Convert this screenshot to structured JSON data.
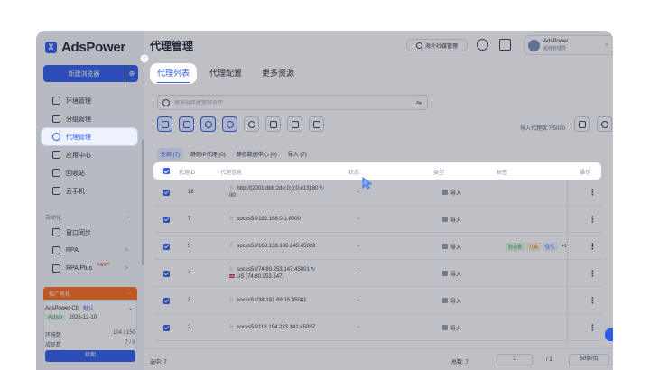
{
  "app": {
    "name": "AdsPower",
    "logo_letter": "X"
  },
  "sidebar": {
    "new_browser": "新建浏览器",
    "new_browser_plus": "⊕",
    "items": [
      {
        "label": "环境管理",
        "icon": "window-icon"
      },
      {
        "label": "分组管理",
        "icon": "folder-icon"
      },
      {
        "label": "代理管理",
        "icon": "proxy-icon"
      },
      {
        "label": "应用中心",
        "icon": "apps-icon"
      },
      {
        "label": "回收站",
        "icon": "trash-icon"
      },
      {
        "label": "云手机",
        "icon": "phone-icon"
      }
    ],
    "section_label": "自动化",
    "section_chevron": "⌄",
    "auto_items": [
      {
        "label": "窗口同步",
        "icon": "sync-icon",
        "chevron": ""
      },
      {
        "label": "RPA",
        "icon": "rpa-icon",
        "chevron": ">"
      },
      {
        "label": "RPA Plus",
        "icon": "rpa-plus-icon",
        "chevron": ">",
        "badge": "NEW!"
      }
    ],
    "promo": {
      "label": "推广有礼",
      "arrow": "→"
    },
    "team": {
      "name": "AdsPower-CN",
      "tag": "默认",
      "chevron": "⌄"
    },
    "plan": {
      "status": "Active",
      "date": "2026-12-10"
    },
    "stats": [
      {
        "label": "环境数",
        "value": "104 / 150"
      },
      {
        "label": "成员数",
        "value": "7 / 9"
      }
    ],
    "renew": "续期"
  },
  "header": {
    "title": "代理管理",
    "social_button": "海外社媒管理",
    "user": {
      "name": "AdsPower",
      "role": "超级管理员",
      "chevron": ">"
    }
  },
  "tabs": [
    {
      "label": "代理列表",
      "active": true
    },
    {
      "label": "代理配置",
      "active": false
    },
    {
      "label": "更多资源",
      "active": false
    }
  ],
  "search": {
    "placeholder": "搜索或新建搜索条件",
    "filter_icon": "⇋"
  },
  "toolbar": {
    "import_count": "导入代理数:7/5000",
    "buttons": [
      "cloud-icon",
      "bag-icon",
      "refresh-check-icon",
      "search-check-icon",
      "sync-icon",
      "upload-icon",
      "tag-icon",
      "delete-icon"
    ],
    "right_buttons": [
      "tag-icon",
      "settings-icon",
      "refresh-icon"
    ]
  },
  "subtabs": [
    {
      "label": "全部 (7)",
      "active": true
    },
    {
      "label": "静态IP代理 (0)",
      "active": false
    },
    {
      "label": "静态数据中心 (0)",
      "active": false
    },
    {
      "label": "导入 (7)",
      "active": false
    }
  ],
  "table": {
    "headers": {
      "id": "代理ID",
      "info": "代理信息",
      "status": "状态",
      "type": "类型",
      "tags": "标签",
      "ops": "操作"
    },
    "rows": [
      {
        "id": "16",
        "info": "http://[2001:db8:2de:0:0:0:e13]:80",
        "info2": "00",
        "refresh": "↻",
        "status": "-",
        "type": "导入",
        "tags": []
      },
      {
        "id": "7",
        "info": "socks5://192.168.0.1:8000",
        "info2": "",
        "refresh": "",
        "status": "-",
        "type": "导入",
        "tags": []
      },
      {
        "id": "5",
        "info": "socks5://168.138.186.245:45028",
        "info2": "",
        "refresh": "",
        "status": "-",
        "type": "导入",
        "tags": [
          {
            "text": "亚马逊",
            "color": "green"
          },
          {
            "text": "儿童",
            "color": "orange"
          },
          {
            "text": "住宅",
            "color": "blue"
          }
        ],
        "tags2": "+1"
      },
      {
        "id": "4",
        "info": "socks5://74.80.253.147:45001",
        "info2": "US (74.80.253.147)",
        "refresh": "↻",
        "flag": true,
        "status": "-",
        "type": "导入",
        "tags": []
      },
      {
        "id": "3",
        "info": "socks5://38.181.69.15:45001",
        "info2": "",
        "refresh": "",
        "status": "-",
        "type": "导入",
        "tags": []
      },
      {
        "id": "2",
        "info": "socks5://118.194.233.141:45007",
        "info2": "",
        "refresh": "",
        "status": "-",
        "type": "导入",
        "tags": []
      }
    ],
    "ops_glyph": "⋮"
  },
  "footer": {
    "selected": "选中: 7",
    "total": "总数: 7",
    "page": "1",
    "pages": "/ 1",
    "per_page": "50条/页"
  }
}
